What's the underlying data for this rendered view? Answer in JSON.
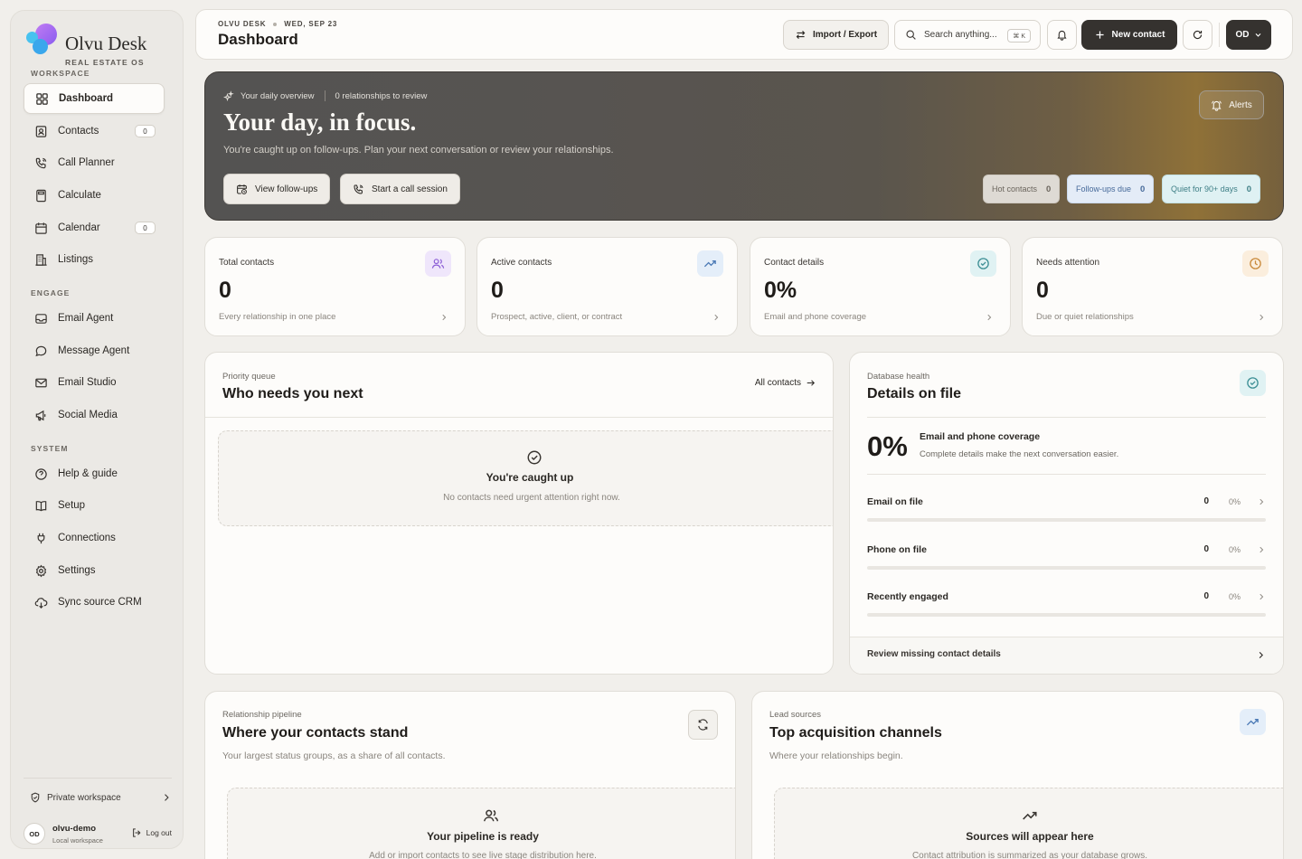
{
  "brand": {
    "name": "Olvu Desk",
    "subtitle": "REAL ESTATE OS"
  },
  "sidebar": {
    "sections": [
      {
        "label": "WORKSPACE",
        "items": [
          {
            "label": "Dashboard",
            "icon": "grid-icon",
            "active": true
          },
          {
            "label": "Contacts",
            "icon": "contact-card-icon",
            "count": "0"
          },
          {
            "label": "Call Planner",
            "icon": "phone-icon"
          },
          {
            "label": "Calculate",
            "icon": "calculator-icon"
          },
          {
            "label": "Calendar",
            "icon": "calendar-icon",
            "count": "0"
          },
          {
            "label": "Listings",
            "icon": "building-icon"
          }
        ]
      },
      {
        "label": "ENGAGE",
        "items": [
          {
            "label": "Email Agent",
            "icon": "inbox-icon"
          },
          {
            "label": "Message Agent",
            "icon": "chat-bubble-icon"
          },
          {
            "label": "Email Studio",
            "icon": "mail-icon"
          },
          {
            "label": "Social Media",
            "icon": "megaphone-icon"
          }
        ]
      },
      {
        "label": "SYSTEM",
        "items": [
          {
            "label": "Help & guide",
            "icon": "help-circle-icon"
          },
          {
            "label": "Setup",
            "icon": "book-icon"
          },
          {
            "label": "Connections",
            "icon": "plug-icon"
          },
          {
            "label": "Settings",
            "icon": "gear-icon"
          },
          {
            "label": "Sync source CRM",
            "icon": "cloud-sync-icon"
          }
        ]
      }
    ],
    "footer": {
      "workspace_label": "Private workspace",
      "avatar_initials": "OD",
      "user_name": "olvu-demo",
      "user_sub": "Local workspace",
      "logout_label": "Log out"
    }
  },
  "header": {
    "breadcrumb_app": "OLVU DESK",
    "breadcrumb_date": "WED, SEP 23",
    "title": "Dashboard",
    "import_export_label": "Import / Export",
    "search_placeholder": "Search anything...",
    "search_shortcut": "⌘ K",
    "new_contact_label": "New contact",
    "user_menu_label": "OD"
  },
  "hero": {
    "tag": "Your daily overview",
    "review_note": "0 relationships to review",
    "title": "Your day, in focus.",
    "subtitle": "You're caught up on follow-ups. Plan your next conversation or review your relationships.",
    "view_followups_label": "View follow-ups",
    "call_session_label": "Start a call session",
    "alerts_label": "Alerts",
    "pills": [
      {
        "label": "Hot contacts",
        "count": "0",
        "bg": "#dedad4",
        "fg": "#6b655d",
        "border": "#cfcac2"
      },
      {
        "label": "Follow-ups due",
        "count": "0",
        "bg": "#e4ecf7",
        "fg": "#476a9a",
        "border": "#cbd9ec"
      },
      {
        "label": "Quiet for 90+ days",
        "count": "0",
        "bg": "#dff1f3",
        "fg": "#3f7f86",
        "border": "#c3e1e4"
      }
    ]
  },
  "stats": [
    {
      "label": "Total contacts",
      "value": "0",
      "desc": "Every relationship in one place",
      "icon": "users-icon",
      "icon_bg": "#efe6fb",
      "icon_fg": "#8c5fd6"
    },
    {
      "label": "Active contacts",
      "value": "0",
      "desc": "Prospect, active, client, or contract",
      "icon": "trend-up-icon",
      "icon_bg": "#e4eef9",
      "icon_fg": "#4a79b5"
    },
    {
      "label": "Contact details",
      "value": "0%",
      "desc": "Email and phone coverage",
      "icon": "check-circle-icon",
      "icon_bg": "#e0f2f3",
      "icon_fg": "#3d8f95"
    },
    {
      "label": "Needs attention",
      "value": "0",
      "desc": "Due or quiet relationships",
      "icon": "clock-icon",
      "icon_bg": "#fbeedd",
      "icon_fg": "#c98a3c"
    }
  ],
  "priority": {
    "eyebrow": "Priority queue",
    "title": "Who needs you next",
    "link_label": "All contacts",
    "empty_title": "You're caught up",
    "empty_desc": "No contacts need urgent attention right now."
  },
  "health": {
    "eyebrow": "Database health",
    "title": "Details on file",
    "big_value": "0%",
    "big_label": "Email and phone coverage",
    "big_desc": "Complete details make the next conversation easier.",
    "rows": [
      {
        "label": "Email on file",
        "count": "0",
        "percent": "0%",
        "fraction": 0
      },
      {
        "label": "Phone on file",
        "count": "0",
        "percent": "0%",
        "fraction": 0
      },
      {
        "label": "Recently engaged",
        "count": "0",
        "percent": "0%",
        "fraction": 0
      }
    ],
    "footer_link": "Review missing contact details"
  },
  "pipeline": {
    "eyebrow": "Relationship pipeline",
    "title": "Where your contacts stand",
    "subtitle": "Your largest status groups, as a share of all contacts.",
    "empty_title": "Your pipeline is ready",
    "empty_desc": "Add or import contacts to see live stage distribution here."
  },
  "sources": {
    "eyebrow": "Lead sources",
    "title": "Top acquisition channels",
    "subtitle": "Where your relationships begin.",
    "empty_title": "Sources will appear here",
    "empty_desc": "Contact attribution is summarized as your database grows."
  }
}
